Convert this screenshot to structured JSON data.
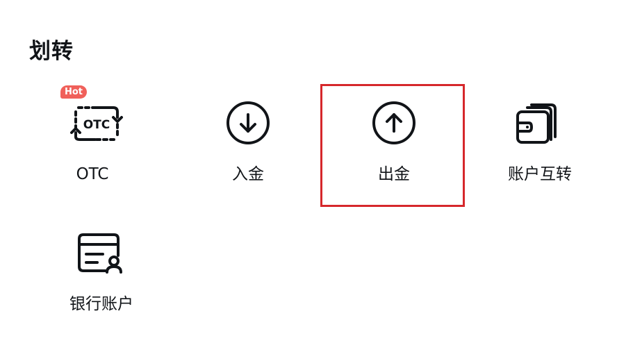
{
  "section": {
    "title": "划转"
  },
  "tiles": [
    {
      "label": "OTC",
      "badge": "Hot",
      "icon": "otc-exchange-icon",
      "ocr": "OTC"
    },
    {
      "label": "入金",
      "icon": "arrow-down-circle-icon"
    },
    {
      "label": "出金",
      "icon": "arrow-up-circle-icon",
      "highlighted": true
    },
    {
      "label": "账户互转",
      "icon": "wallet-cards-icon"
    },
    {
      "label": "银行账户",
      "icon": "bank-card-user-icon"
    }
  ],
  "colors": {
    "text": "#111418",
    "badge": "#f0605a",
    "highlight": "#d6272b",
    "background": "#ffffff"
  }
}
